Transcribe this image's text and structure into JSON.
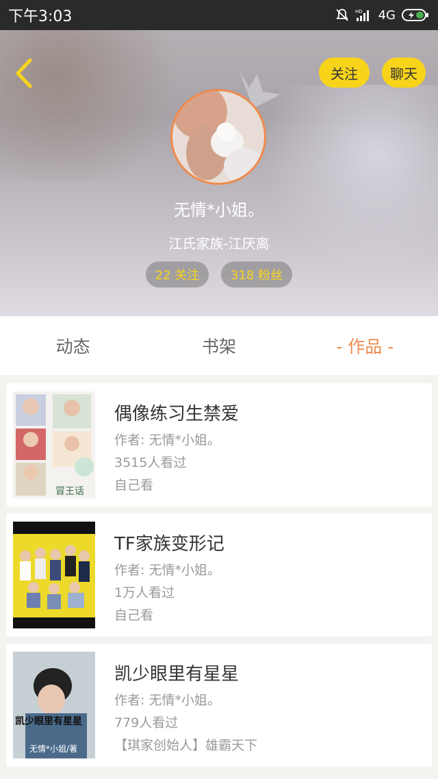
{
  "status_bar": {
    "time": "下午3:03",
    "network": "4G"
  },
  "header": {
    "follow_label": "关注",
    "chat_label": "聊天"
  },
  "profile": {
    "name": "无情*小姐。",
    "subtitle": "江氏家族-江厌离",
    "following": "22 关注",
    "fans": "318 粉丝"
  },
  "tabs": [
    {
      "label": "动态",
      "active": false
    },
    {
      "label": "书架",
      "active": false
    },
    {
      "label": "- 作品 -",
      "active": true
    }
  ],
  "works": [
    {
      "title": "偶像练习生禁爱",
      "author": "作者: 无情*小姐。",
      "views": "3515人看过",
      "extra": "自己看"
    },
    {
      "title": "TF家族变形记",
      "author": "作者: 无情*小姐。",
      "views": "1万人看过",
      "extra": "自己看"
    },
    {
      "title": "凯少眼里有星星",
      "author": "作者: 无情*小姐。",
      "views": "779人看过",
      "extra": "【琪家创始人】雄霸天下",
      "cover_text": [
        "凯少眼里有星星",
        "无情*小姐/著"
      ]
    }
  ],
  "cover2_text": "冒王话",
  "colors": {
    "accent": "#f08a4b",
    "yellow": "#f7d41a"
  }
}
